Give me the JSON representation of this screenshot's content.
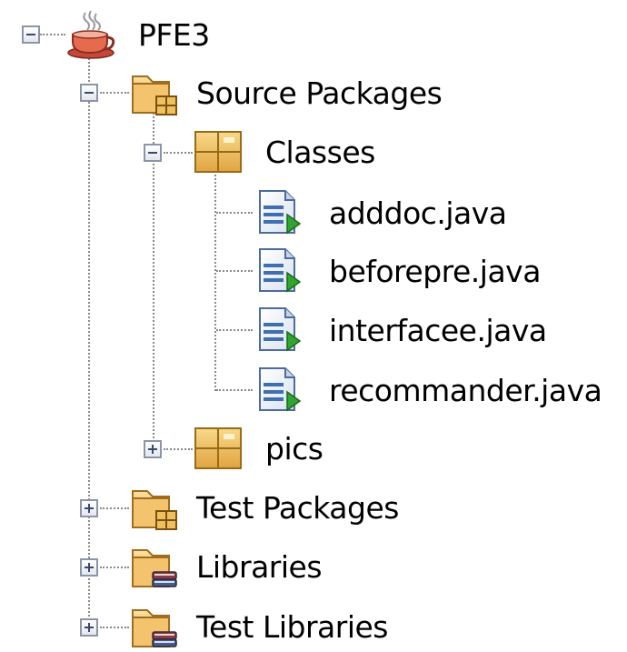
{
  "tree": {
    "project": {
      "label": "PFE3",
      "icon": "java-project-icon",
      "expanded": true
    },
    "source_packages": {
      "label": "Source Packages",
      "icon": "source-packages-folder-icon",
      "expanded": true
    },
    "classes": {
      "label": "Classes",
      "icon": "package-icon",
      "expanded": true
    },
    "files": [
      {
        "label": "adddoc.java",
        "icon": "java-file-icon"
      },
      {
        "label": "beforepre.java",
        "icon": "java-file-icon"
      },
      {
        "label": "interfacee.java",
        "icon": "java-file-icon"
      },
      {
        "label": "recommander.java",
        "icon": "java-file-icon"
      }
    ],
    "pics": {
      "label": "pics",
      "icon": "package-icon",
      "expanded": false
    },
    "test_packages": {
      "label": "Test Packages",
      "icon": "test-packages-folder-icon",
      "expanded": false
    },
    "libraries": {
      "label": "Libraries",
      "icon": "libraries-folder-icon",
      "expanded": false
    },
    "test_libraries": {
      "label": "Test Libraries",
      "icon": "test-libraries-folder-icon",
      "expanded": false
    }
  },
  "colors": {
    "folder": "#e8b75a",
    "package": "#e9b84e",
    "file_blue": "#3f6fae",
    "run_green": "#2fa52f",
    "connector": "#8a8a8a"
  }
}
